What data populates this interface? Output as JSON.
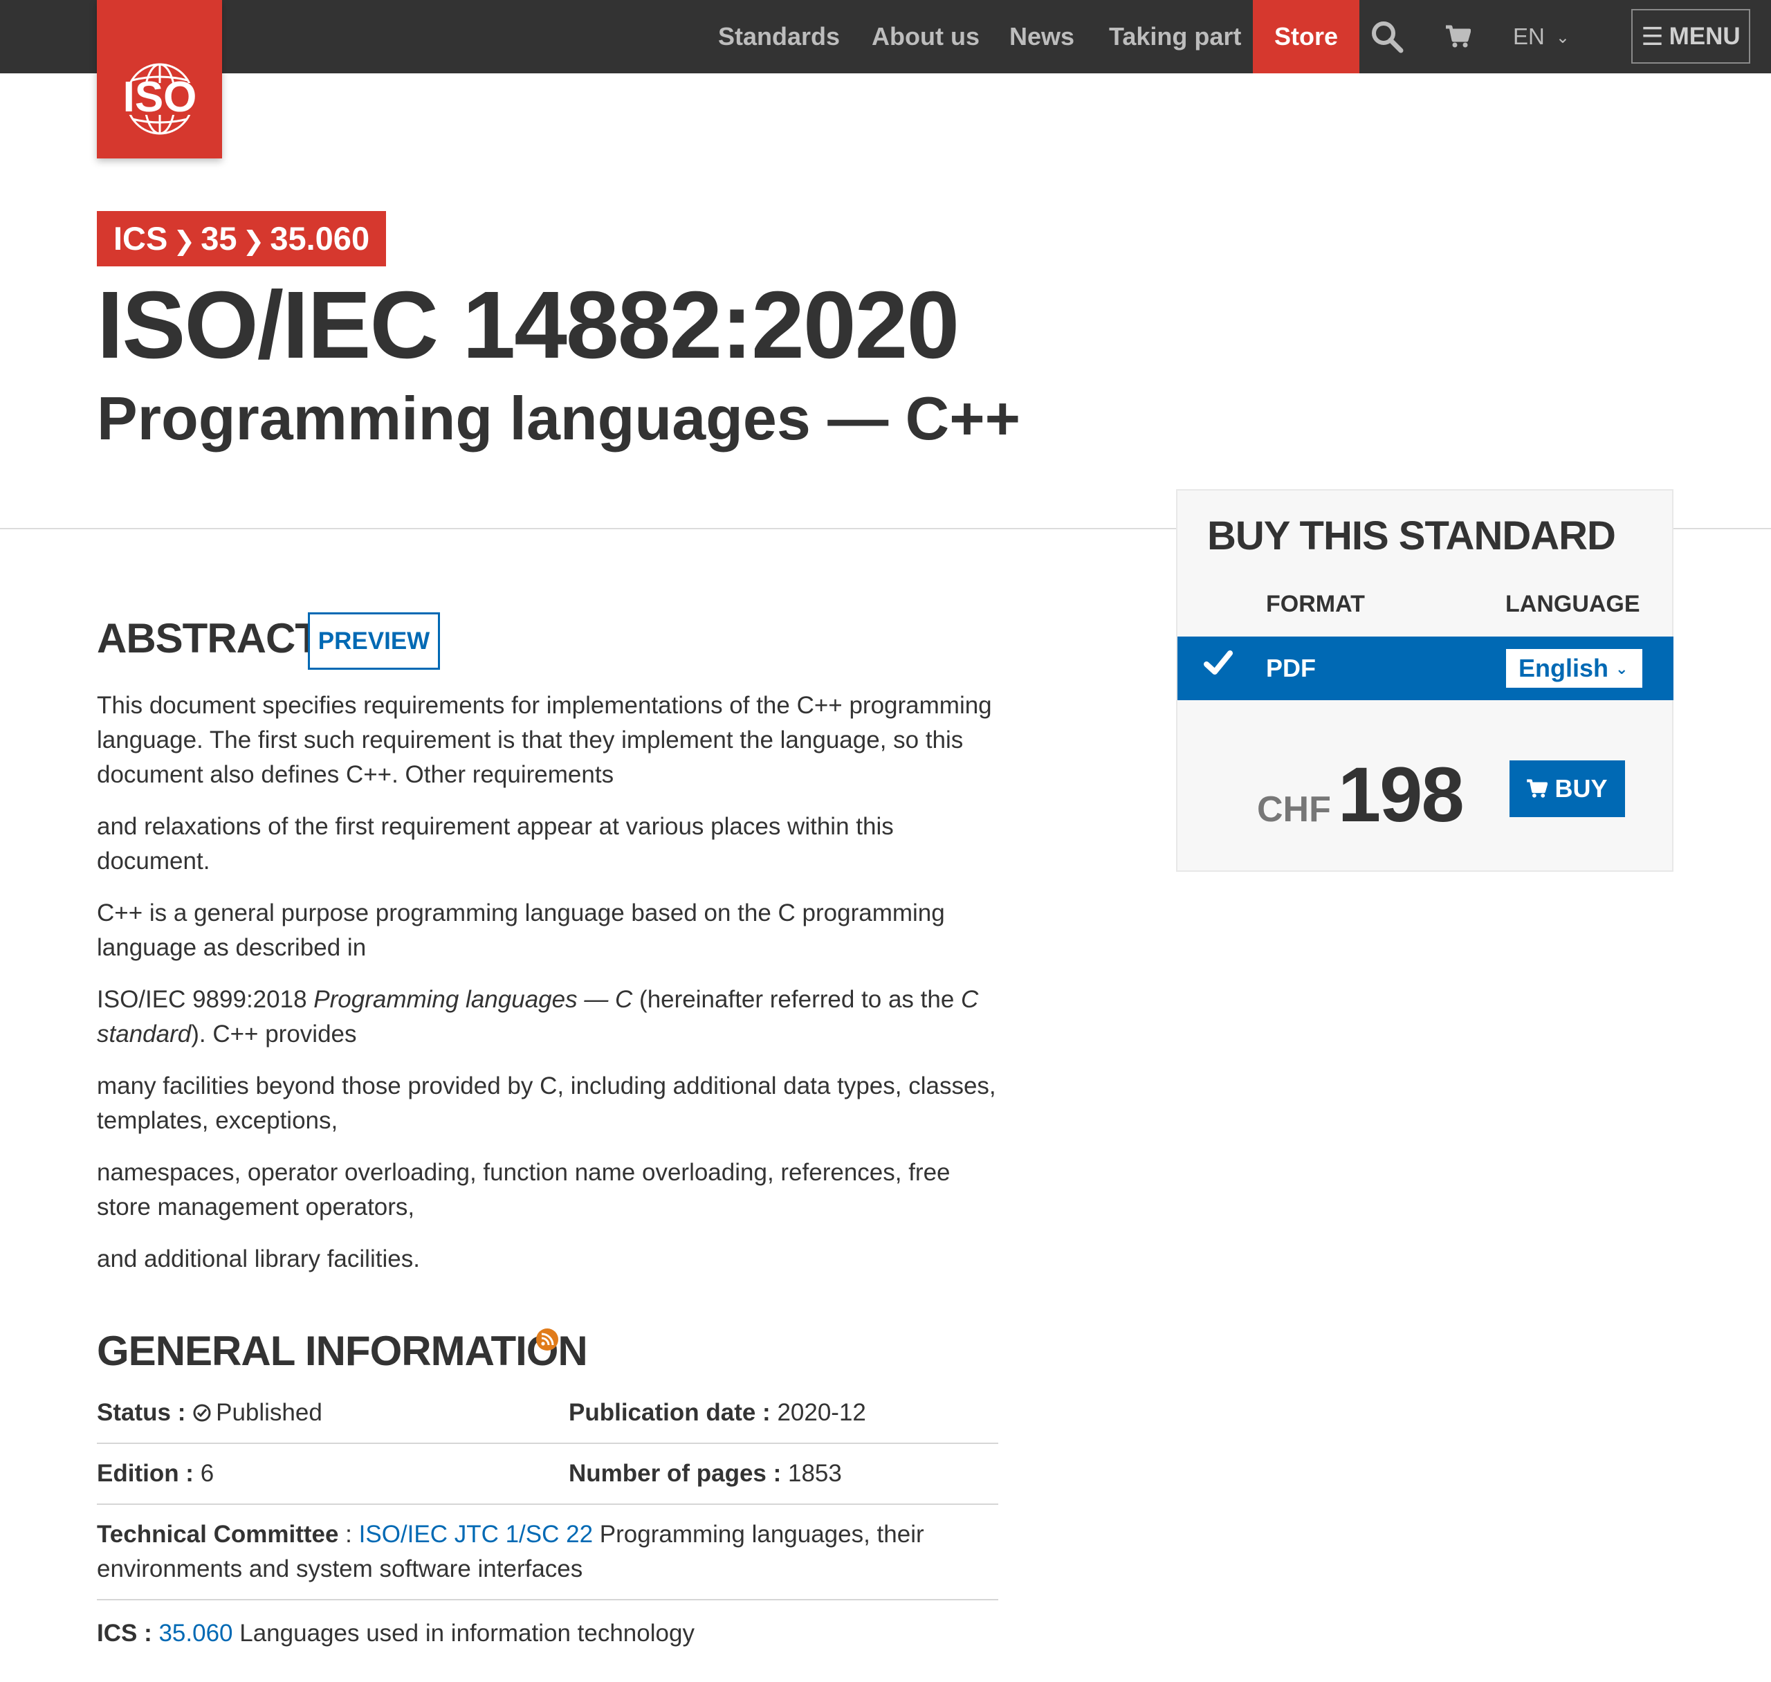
{
  "nav": {
    "items": [
      "Standards",
      "About us",
      "News",
      "Taking part"
    ],
    "store": "Store",
    "language": "EN",
    "menu": "MENU"
  },
  "logo": {
    "text": "ISO"
  },
  "header": {
    "ics_path": [
      "ICS",
      "35",
      "35.060"
    ],
    "title": "ISO/IEC 14882:2020",
    "subtitle": "Programming languages — C++"
  },
  "buy": {
    "title": "BUY THIS STANDARD",
    "format_header": "FORMAT",
    "language_header": "LANGUAGE",
    "format": "PDF",
    "language": "English",
    "currency": "CHF",
    "price": "198",
    "buy_label": "BUY"
  },
  "abstract": {
    "title": "ABSTRACT",
    "preview_label": "PREVIEW",
    "p1": "This document specifies requirements for implementations of the C++ programming language. The first such requirement is that they implement the language, so this document also defines C++. Other requirements",
    "p2": "and relaxations of the first requirement appear at various places within this document.",
    "p3": "C++ is a general purpose programming language based on the C programming language as described in",
    "p4_a": "ISO/IEC 9899:2018 ",
    "p4_b": "Programming languages — C",
    "p4_c": " (hereinafter referred to as the ",
    "p4_d": "C standard",
    "p4_e": "). C++ provides",
    "p5": "many facilities beyond those provided by C, including additional data types, classes, templates, exceptions,",
    "p6": "namespaces, operator overloading, function name overloading, references, free store management operators,",
    "p7": "and additional library facilities."
  },
  "general": {
    "title": "GENERAL INFORMATION",
    "status_label": "Status :",
    "status_value": "Published",
    "pubdate_label": "Publication date :",
    "pubdate_value": "2020-12",
    "edition_label": "Edition :",
    "edition_value": "6",
    "pages_label": "Number of pages :",
    "pages_value": "1853",
    "tc_label": "Technical Committee",
    "tc_sep": " : ",
    "tc_link": "ISO/IEC JTC 1/SC 22",
    "tc_desc": " Programming languages, their environments and system software interfaces",
    "ics_label": "ICS :",
    "ics_link": "35.060",
    "ics_desc": " Languages used in information technology"
  }
}
